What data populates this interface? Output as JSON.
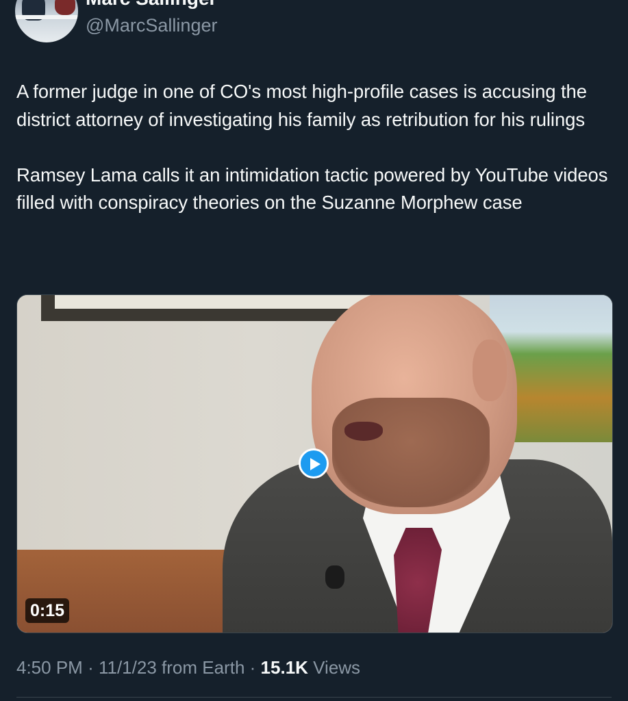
{
  "header": {
    "display_name": "Marc Sallinger",
    "handle": "@MarcSallinger",
    "avatar_icon": "user-avatar"
  },
  "tweet": {
    "paragraphs": [
      "A former judge in one of CO's most high-profile cases is accusing the district attorney of investigating his family as retribution for his rulings",
      "Ramsey Lama calls it an intimidation tactic powered by YouTube videos filled with conspiracy theories on the Suzanne Morphew case"
    ]
  },
  "media": {
    "type": "video",
    "duration": "0:15",
    "play_icon": "play-icon"
  },
  "meta": {
    "time": "4:50 PM",
    "separator": "·",
    "date": "11/1/23",
    "source": "from Earth",
    "views_count": "15.1K",
    "views_label": "Views"
  },
  "colors": {
    "background": "#15202b",
    "text_primary": "#f7f9f9",
    "text_secondary": "#8b98a5",
    "accent": "#1d9bf0",
    "border": "#38444d"
  }
}
